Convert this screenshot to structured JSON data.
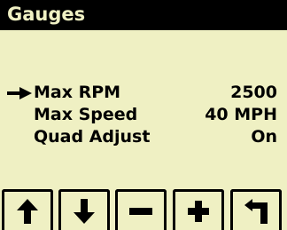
{
  "title": "Gauges",
  "menu": {
    "items": [
      {
        "label": "Max RPM",
        "value": "2500",
        "selected": true
      },
      {
        "label": "Max Speed",
        "value": "40 MPH",
        "selected": false
      },
      {
        "label": "Quad Adjust",
        "value": "On",
        "selected": false
      }
    ]
  },
  "softkeys": [
    {
      "icon": "arrow-up-icon"
    },
    {
      "icon": "arrow-down-icon"
    },
    {
      "icon": "minus-icon"
    },
    {
      "icon": "plus-icon"
    },
    {
      "icon": "return-icon"
    }
  ],
  "colors": {
    "background": "#eff0c3",
    "foreground": "#000000"
  }
}
